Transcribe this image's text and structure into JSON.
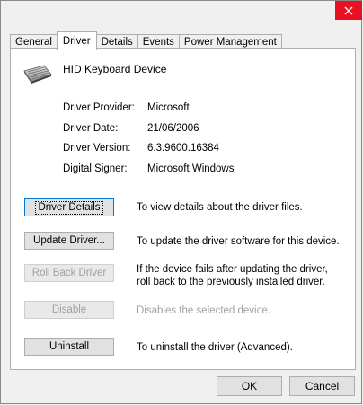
{
  "window": {
    "close_icon": "close-icon"
  },
  "tabs": [
    {
      "label": "General",
      "active": false
    },
    {
      "label": "Driver",
      "active": true
    },
    {
      "label": "Details",
      "active": false
    },
    {
      "label": "Events",
      "active": false
    },
    {
      "label": "Power Management",
      "active": false
    }
  ],
  "device": {
    "name": "HID Keyboard Device",
    "icon": "keyboard-icon"
  },
  "info": [
    {
      "label": "Driver Provider:",
      "value": "Microsoft"
    },
    {
      "label": "Driver Date:",
      "value": "21/06/2006"
    },
    {
      "label": "Driver Version:",
      "value": "6.3.9600.16384"
    },
    {
      "label": "Digital Signer:",
      "value": "Microsoft Windows"
    }
  ],
  "actions": [
    {
      "label": "Driver Details",
      "description": "To view details about the driver files.",
      "enabled": true,
      "focused": true
    },
    {
      "label": "Update Driver...",
      "description": "To update the driver software for this device.",
      "enabled": true,
      "focused": false
    },
    {
      "label": "Roll Back Driver",
      "description": "If the device fails after updating the driver, roll back to the previously installed driver.",
      "enabled": false,
      "focused": false
    },
    {
      "label": "Disable",
      "description": "Disables the selected device.",
      "enabled": false,
      "focused": false
    },
    {
      "label": "Uninstall",
      "description": "To uninstall the driver (Advanced).",
      "enabled": true,
      "focused": false
    }
  ],
  "footer": {
    "ok_label": "OK",
    "cancel_label": "Cancel"
  },
  "colors": {
    "close_bg": "#e81123",
    "focus_border": "#0078d7",
    "disabled_text": "#a0a0a0"
  }
}
